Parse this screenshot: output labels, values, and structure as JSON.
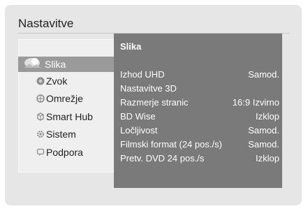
{
  "header": {
    "title": "Nastavitve"
  },
  "menu": {
    "items": [
      {
        "label": "Slika",
        "icon": "picture-icon",
        "selected": true
      },
      {
        "label": "Zvok",
        "icon": "speaker-icon",
        "selected": false
      },
      {
        "label": "Omrežje",
        "icon": "network-icon",
        "selected": false
      },
      {
        "label": "Smart Hub",
        "icon": "smart-hub-icon",
        "selected": false
      },
      {
        "label": "Sistem",
        "icon": "gear-icon",
        "selected": false
      },
      {
        "label": "Podpora",
        "icon": "support-icon",
        "selected": false
      }
    ]
  },
  "panel": {
    "title": "Slika",
    "settings": [
      {
        "label": "Izhod UHD",
        "value": "Samod."
      },
      {
        "label": "Nastavitve 3D",
        "value": ""
      },
      {
        "label": "Razmerje stranic",
        "value": "16:9 Izvirno"
      },
      {
        "label": "BD Wise",
        "value": "Izklop"
      },
      {
        "label": "Ločljivost",
        "value": "Samod."
      },
      {
        "label": "Filmski format (24 pos./s)",
        "value": "Samod."
      },
      {
        "label": "Pretv. DVD 24 pos./s",
        "value": "Izklop"
      }
    ]
  },
  "colors": {
    "background": "#e6e6e6",
    "selected_item": "#9a9a9a",
    "panel": "#7a7a7a",
    "text_light": "#ffffff",
    "text_dark": "#222222"
  }
}
